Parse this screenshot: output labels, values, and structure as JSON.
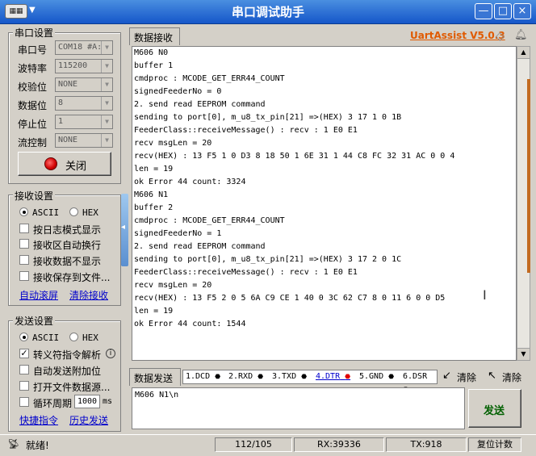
{
  "window": {
    "title": "串口调试助手",
    "min": "—",
    "max": "□",
    "close": "×",
    "app_icon_text": "▦▦"
  },
  "serial_settings": {
    "title": "串口设置",
    "port_label": "串口号",
    "port_value": "COM18 #A:",
    "baud_label": "波特率",
    "baud_value": "115200",
    "parity_label": "校验位",
    "parity_value": "NONE",
    "databits_label": "数据位",
    "databits_value": "8",
    "stopbits_label": "停止位",
    "stopbits_value": "1",
    "flow_label": "流控制",
    "flow_value": "NONE",
    "close_button": "关闭"
  },
  "recv_settings": {
    "title": "接收设置",
    "ascii": "ASCII",
    "hex": "HEX",
    "log_mode": "按日志模式显示",
    "auto_wrap": "接收区自动换行",
    "no_display": "接收数据不显示",
    "save_to_file": "接收保存到文件...",
    "auto_scroll": "自动滚屏",
    "clear_recv": "清除接收"
  },
  "send_settings": {
    "title": "发送设置",
    "ascii": "ASCII",
    "hex": "HEX",
    "escape_parse": "转义符指令解析",
    "auto_append": "自动发送附加位",
    "open_file": "打开文件数据源...",
    "cycle": "循环周期",
    "cycle_value": "1000",
    "cycle_unit": "ms",
    "quick_cmd": "快捷指令",
    "history": "历史发送"
  },
  "recv_area": {
    "tab": "数据接收",
    "brand": "UartAssist V5.0.3",
    "lines": [
      "M606 N0",
      "buffer 1",
      "cmdproc : MCODE_GET_ERR44_COUNT",
      "signedFeederNo = 0",
      "2. send read EEPROM command",
      "sending to port[0], m_u8_tx_pin[21] =>(HEX) 3 17 1 0 1B",
      "FeederClass::receiveMessage() : recv : 1 E0 E1",
      "recv msgLen = 20",
      "recv(HEX) : 13 F5 1 0 D3 8 18 50 1 6E 31 1 44 C8 FC 32 31 AC 0 0 4",
      "len = 19",
      "ok Error 44 count: 3324",
      "M606 N1",
      "buffer 2",
      "cmdproc : MCODE_GET_ERR44_COUNT",
      "signedFeederNo = 1",
      "2. send read EEPROM command",
      "sending to port[0], m_u8_tx_pin[21] =>(HEX) 3 17 2 0 1C",
      "FeederClass::receiveMessage() : recv : 1 E0 E1",
      "recv msgLen = 20",
      "recv(HEX) : 13 F5 2 0 5 6A C9 CE 1 40 0 3C 62 C7 8 0 11 6 0 0 D5",
      "len = 19",
      "ok Error 44 count: 1544"
    ]
  },
  "send_area": {
    "tab": "数据发送",
    "pins": [
      "1.DCD",
      "2.RXD",
      "3.TXD",
      "4.DTR",
      "5.GND",
      "6.DSR"
    ],
    "clear1": "清除",
    "clear2": "清除",
    "text": "M606 N1\\n",
    "send_button": "发送"
  },
  "statusbar": {
    "status": "就绪!",
    "counter": "112/105",
    "rx": "RX:39336",
    "tx": "TX:918",
    "reset": "复位计数"
  },
  "colors": {
    "title_bg": "#1556c9",
    "brand": "#e05a00",
    "link": "#0000cc",
    "led_red": "#e00000"
  }
}
